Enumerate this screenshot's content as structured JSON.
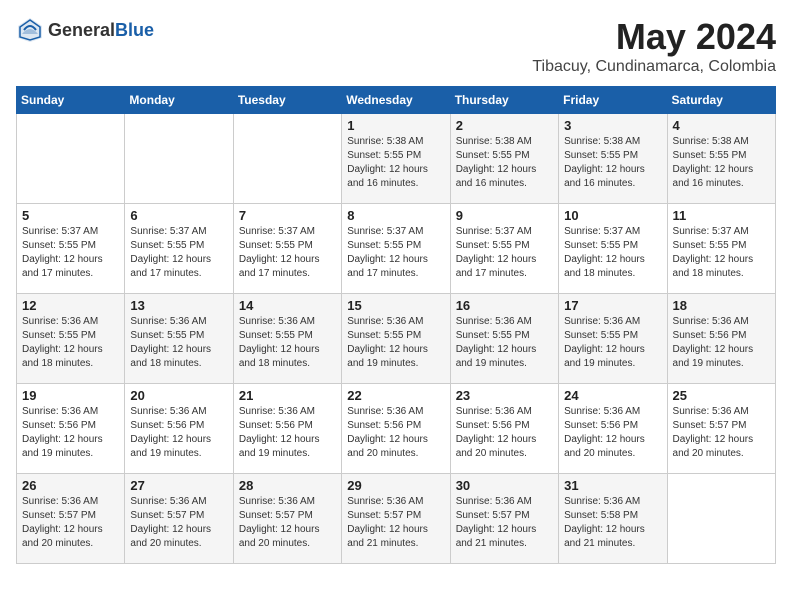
{
  "header": {
    "logo_general": "General",
    "logo_blue": "Blue",
    "month_year": "May 2024",
    "location": "Tibacuy, Cundinamarca, Colombia"
  },
  "weekdays": [
    "Sunday",
    "Monday",
    "Tuesday",
    "Wednesday",
    "Thursday",
    "Friday",
    "Saturday"
  ],
  "weeks": [
    [
      {
        "day": "",
        "content": ""
      },
      {
        "day": "",
        "content": ""
      },
      {
        "day": "",
        "content": ""
      },
      {
        "day": "1",
        "content": "Sunrise: 5:38 AM\nSunset: 5:55 PM\nDaylight: 12 hours\nand 16 minutes."
      },
      {
        "day": "2",
        "content": "Sunrise: 5:38 AM\nSunset: 5:55 PM\nDaylight: 12 hours\nand 16 minutes."
      },
      {
        "day": "3",
        "content": "Sunrise: 5:38 AM\nSunset: 5:55 PM\nDaylight: 12 hours\nand 16 minutes."
      },
      {
        "day": "4",
        "content": "Sunrise: 5:38 AM\nSunset: 5:55 PM\nDaylight: 12 hours\nand 16 minutes."
      }
    ],
    [
      {
        "day": "5",
        "content": "Sunrise: 5:37 AM\nSunset: 5:55 PM\nDaylight: 12 hours\nand 17 minutes."
      },
      {
        "day": "6",
        "content": "Sunrise: 5:37 AM\nSunset: 5:55 PM\nDaylight: 12 hours\nand 17 minutes."
      },
      {
        "day": "7",
        "content": "Sunrise: 5:37 AM\nSunset: 5:55 PM\nDaylight: 12 hours\nand 17 minutes."
      },
      {
        "day": "8",
        "content": "Sunrise: 5:37 AM\nSunset: 5:55 PM\nDaylight: 12 hours\nand 17 minutes."
      },
      {
        "day": "9",
        "content": "Sunrise: 5:37 AM\nSunset: 5:55 PM\nDaylight: 12 hours\nand 17 minutes."
      },
      {
        "day": "10",
        "content": "Sunrise: 5:37 AM\nSunset: 5:55 PM\nDaylight: 12 hours\nand 18 minutes."
      },
      {
        "day": "11",
        "content": "Sunrise: 5:37 AM\nSunset: 5:55 PM\nDaylight: 12 hours\nand 18 minutes."
      }
    ],
    [
      {
        "day": "12",
        "content": "Sunrise: 5:36 AM\nSunset: 5:55 PM\nDaylight: 12 hours\nand 18 minutes."
      },
      {
        "day": "13",
        "content": "Sunrise: 5:36 AM\nSunset: 5:55 PM\nDaylight: 12 hours\nand 18 minutes."
      },
      {
        "day": "14",
        "content": "Sunrise: 5:36 AM\nSunset: 5:55 PM\nDaylight: 12 hours\nand 18 minutes."
      },
      {
        "day": "15",
        "content": "Sunrise: 5:36 AM\nSunset: 5:55 PM\nDaylight: 12 hours\nand 19 minutes."
      },
      {
        "day": "16",
        "content": "Sunrise: 5:36 AM\nSunset: 5:55 PM\nDaylight: 12 hours\nand 19 minutes."
      },
      {
        "day": "17",
        "content": "Sunrise: 5:36 AM\nSunset: 5:55 PM\nDaylight: 12 hours\nand 19 minutes."
      },
      {
        "day": "18",
        "content": "Sunrise: 5:36 AM\nSunset: 5:56 PM\nDaylight: 12 hours\nand 19 minutes."
      }
    ],
    [
      {
        "day": "19",
        "content": "Sunrise: 5:36 AM\nSunset: 5:56 PM\nDaylight: 12 hours\nand 19 minutes."
      },
      {
        "day": "20",
        "content": "Sunrise: 5:36 AM\nSunset: 5:56 PM\nDaylight: 12 hours\nand 19 minutes."
      },
      {
        "day": "21",
        "content": "Sunrise: 5:36 AM\nSunset: 5:56 PM\nDaylight: 12 hours\nand 19 minutes."
      },
      {
        "day": "22",
        "content": "Sunrise: 5:36 AM\nSunset: 5:56 PM\nDaylight: 12 hours\nand 20 minutes."
      },
      {
        "day": "23",
        "content": "Sunrise: 5:36 AM\nSunset: 5:56 PM\nDaylight: 12 hours\nand 20 minutes."
      },
      {
        "day": "24",
        "content": "Sunrise: 5:36 AM\nSunset: 5:56 PM\nDaylight: 12 hours\nand 20 minutes."
      },
      {
        "day": "25",
        "content": "Sunrise: 5:36 AM\nSunset: 5:57 PM\nDaylight: 12 hours\nand 20 minutes."
      }
    ],
    [
      {
        "day": "26",
        "content": "Sunrise: 5:36 AM\nSunset: 5:57 PM\nDaylight: 12 hours\nand 20 minutes."
      },
      {
        "day": "27",
        "content": "Sunrise: 5:36 AM\nSunset: 5:57 PM\nDaylight: 12 hours\nand 20 minutes."
      },
      {
        "day": "28",
        "content": "Sunrise: 5:36 AM\nSunset: 5:57 PM\nDaylight: 12 hours\nand 20 minutes."
      },
      {
        "day": "29",
        "content": "Sunrise: 5:36 AM\nSunset: 5:57 PM\nDaylight: 12 hours\nand 21 minutes."
      },
      {
        "day": "30",
        "content": "Sunrise: 5:36 AM\nSunset: 5:57 PM\nDaylight: 12 hours\nand 21 minutes."
      },
      {
        "day": "31",
        "content": "Sunrise: 5:36 AM\nSunset: 5:58 PM\nDaylight: 12 hours\nand 21 minutes."
      },
      {
        "day": "",
        "content": ""
      }
    ]
  ]
}
